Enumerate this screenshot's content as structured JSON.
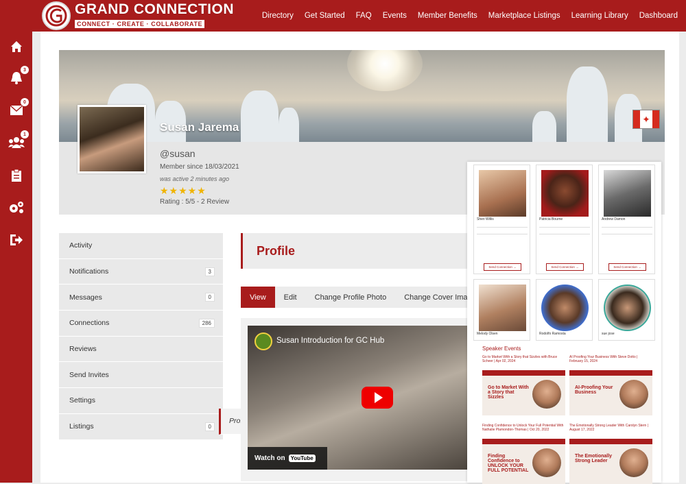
{
  "brand": {
    "title": "GRAND CONNECTION",
    "tagline": "CONNECT · CREATE · COLLABORATE"
  },
  "nav": [
    "Directory",
    "Get Started",
    "FAQ",
    "Events",
    "Member Benefits",
    "Marketplace Listings",
    "Learning Library",
    "Dashboard"
  ],
  "sidebar": {
    "badges": {
      "notifications": "3",
      "messages": "0",
      "connections": "1"
    }
  },
  "profile": {
    "name": "Susan Jarema",
    "handle": "@susan",
    "since": "Member since 18/03/2021",
    "active": "was active 2 minutes ago",
    "stars": "★★★★★",
    "rating": "Rating : 5/5 - 2 Review"
  },
  "menu": [
    {
      "label": "Profile",
      "count": ""
    },
    {
      "label": "Activity",
      "count": ""
    },
    {
      "label": "Notifications",
      "count": "3"
    },
    {
      "label": "Messages",
      "count": "0"
    },
    {
      "label": "Connections",
      "count": "286"
    },
    {
      "label": "Reviews",
      "count": ""
    },
    {
      "label": "Send Invites",
      "count": ""
    },
    {
      "label": "Settings",
      "count": ""
    },
    {
      "label": "Listings",
      "count": "0"
    }
  ],
  "section": {
    "title": "Profile"
  },
  "tabs": [
    "View",
    "Edit",
    "Change Profile Photo",
    "Change Cover Imag"
  ],
  "video": {
    "title": "Susan Introduction for GC Hub",
    "watch": "Watch on",
    "yt": "YouTube"
  },
  "popup": {
    "cards": [
      {
        "name": "Sheri Willis",
        "button": "Send Connection →"
      },
      {
        "name": "Patricia Bourne",
        "button": "Send Connection →"
      },
      {
        "name": "Andrew Damon",
        "button": "Send Connection →"
      },
      {
        "name": "Melody Olsen",
        "button": ""
      },
      {
        "name": "Rodolfo Ramosta",
        "button": ""
      },
      {
        "name": "sue jose",
        "button": ""
      }
    ],
    "speaker_title": "Speaker Events",
    "events": [
      {
        "caption": "Go to Market With a Story that Sizzles with Bruce Scheer | Apr 02, 2024",
        "banner": "Go to Market With a Story that Sizzles"
      },
      {
        "caption": "AI Proofing Your Business With Steve Dotto | February 15, 2024",
        "banner": "AI-Proofing Your Business"
      },
      {
        "caption": "Finding Confidence to Unlock Your Full Potential With Nathalie Plamondon-Thomas | Oct 20, 2022",
        "banner": "Finding Confidence to UNLOCK YOUR FULL POTENTIAL"
      },
      {
        "caption": "The Emotionally Strong Leader With Carolyn Stern | August 17, 2022",
        "banner": "The Emotionally Strong Leader"
      }
    ]
  },
  "colors": {
    "brand": "#a81c1c",
    "star": "#f0b400"
  }
}
